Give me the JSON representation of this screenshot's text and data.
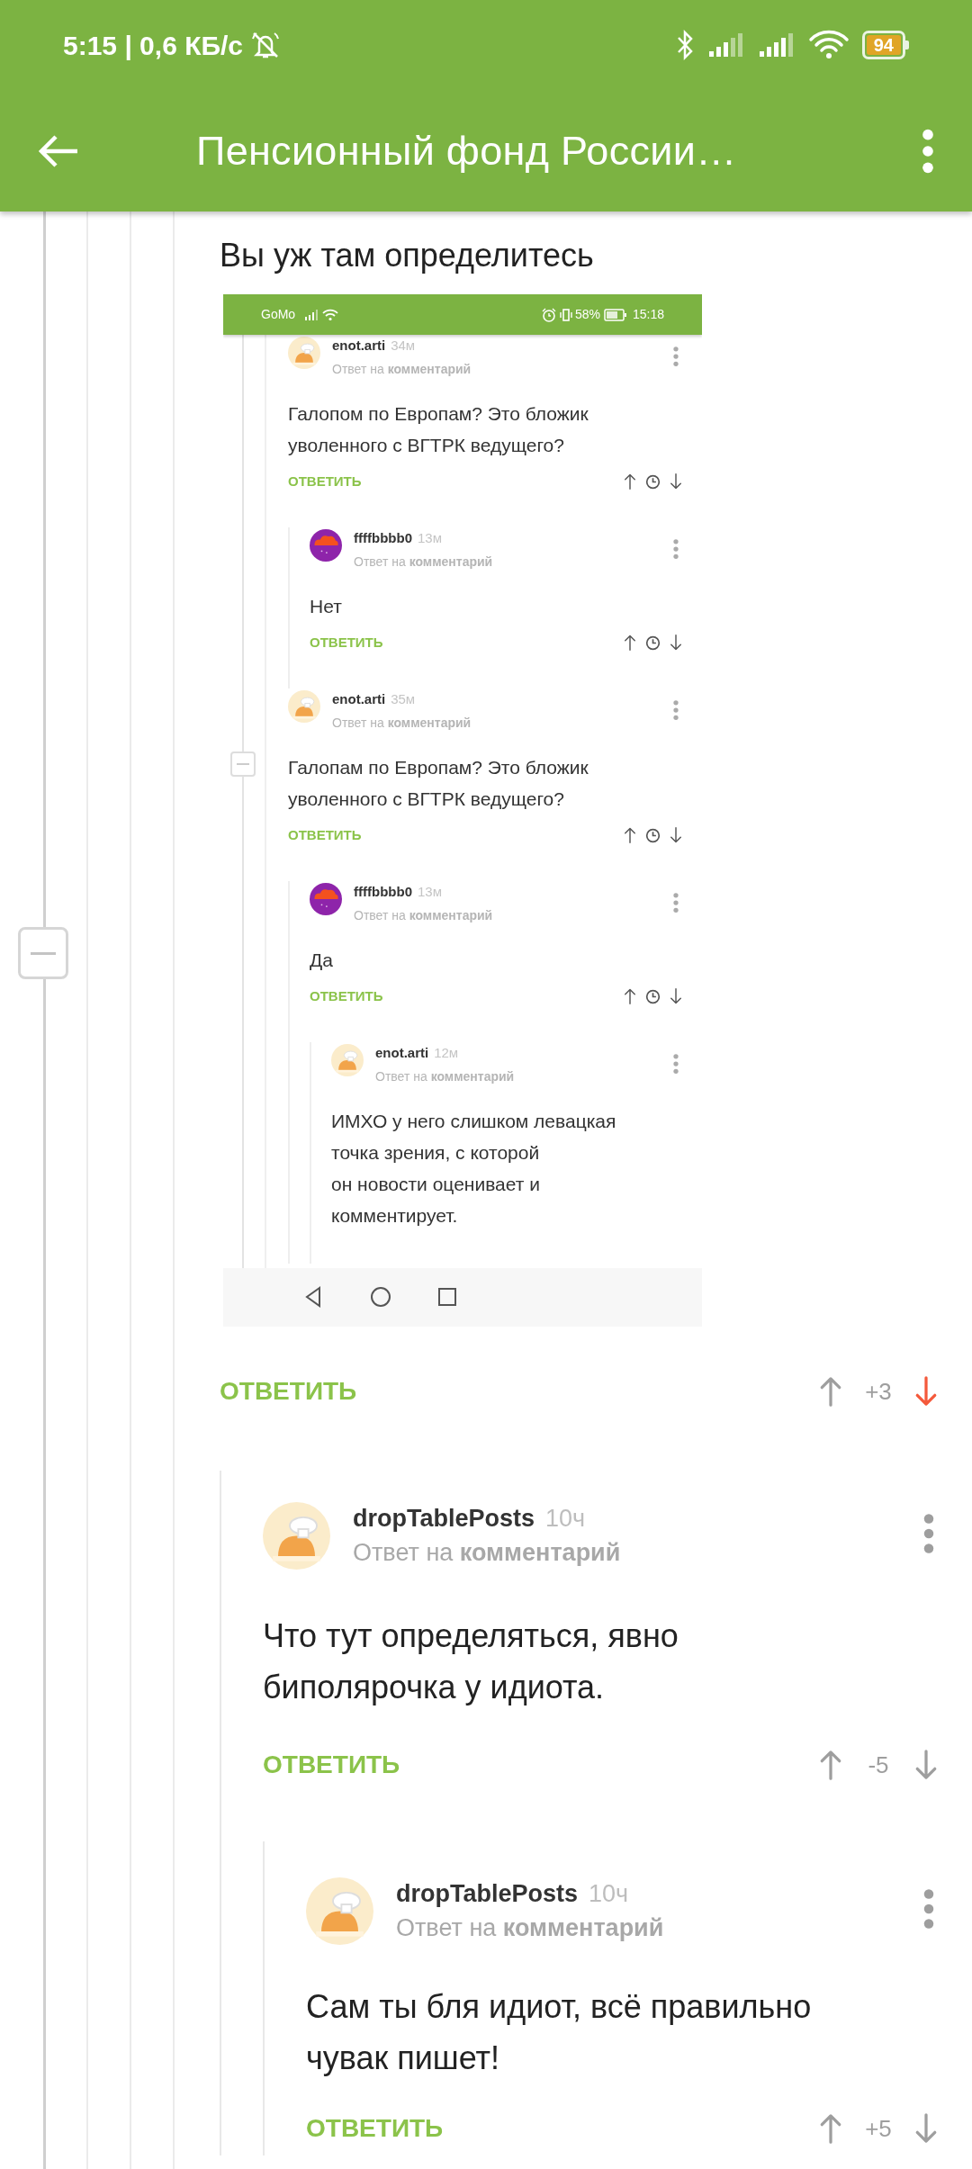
{
  "status_bar": {
    "time": "5:15 | 0,6 КБ/с",
    "battery": "94"
  },
  "toolbar": {
    "title": "Пенсионный фонд России…"
  },
  "comment": {
    "text": "Вы уж там определитесь",
    "screenshot": {
      "status_bar": {
        "carrier": "GoMo",
        "battery": "58%",
        "time": "15:18"
      },
      "comments": [
        {
          "kind": "chef",
          "author": "enot.arti",
          "time": "34м",
          "reply_to": "Ответ на **комментарий**",
          "text": "Галопом по Европам? Это бложик\nуволенного с ВГТРК ведущего?",
          "reply_label": "ОТВЕТИТЬ",
          "replies": [
            {
              "kind": "cloud",
              "author": "ffffbbbb0",
              "time": "13м",
              "reply_to": "Ответ на **комментарий**",
              "text": "Нет",
              "reply_label": "ОТВЕТИТЬ"
            }
          ]
        },
        {
          "kind": "chef",
          "author": "enot.arti",
          "time": "35м",
          "reply_to": "Ответ на **комментарий**",
          "text": "Галопам по Европам? Это бложик\nуволенного с ВГТРК ведущего?",
          "reply_label": "ОТВЕТИТЬ",
          "replies": [
            {
              "kind": "cloud",
              "author": "ffffbbbb0",
              "time": "13м",
              "reply_to": "Ответ на **комментарий**",
              "text": "Да",
              "reply_label": "ОТВЕТИТЬ",
              "replies": [
                {
                  "kind": "chef",
                  "author": "enot.arti",
                  "time": "12м",
                  "reply_to": "Ответ на **комментарий**",
                  "text": "ИМХО у него слишком левацкая\nточка зрения, с которой\nон новости оценивает и\nкомментирует."
                }
              ]
            }
          ]
        }
      ]
    },
    "reply_label": "ОТВЕТИТЬ",
    "score": "+3",
    "voted_down": true,
    "replies": [
      {
        "kind": "chef",
        "author": "dropTablePosts",
        "time": "10ч",
        "reply_to": "Ответ на **комментарий**",
        "text": "Что тут определяться, явно\nбиполярочка у идиота.",
        "reply_label": "ОТВЕТИТЬ",
        "score": "-5",
        "voted_down": false,
        "replies": [
          {
            "kind": "chef",
            "author": "dropTablePosts",
            "time": "10ч",
            "reply_to": "Ответ на **комментарий**",
            "text": "Сам ты бля идиот, всё правильно\nчувак пишет!",
            "reply_label": "ОТВЕТИТЬ",
            "score": "+5",
            "voted_down": false
          }
        ]
      }
    ]
  }
}
